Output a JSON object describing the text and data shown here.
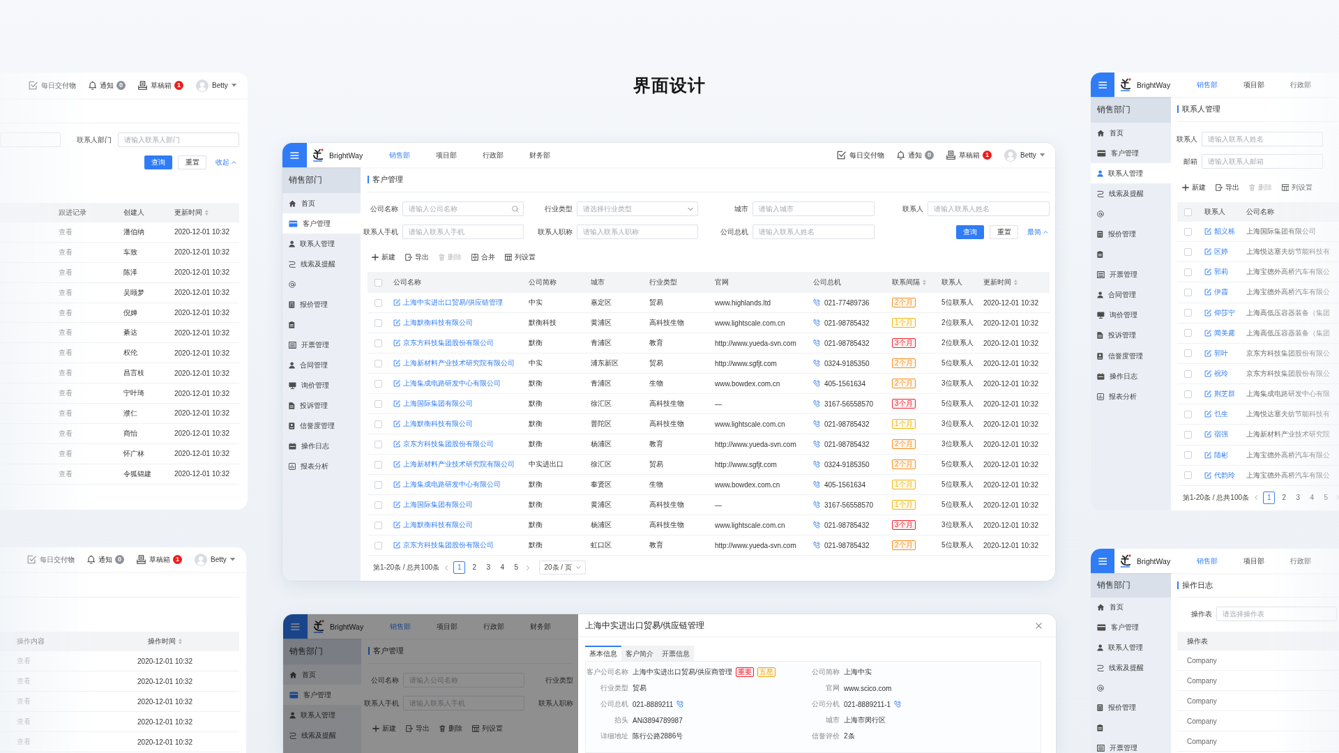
{
  "page_title": "界面设计",
  "customer_window": {
    "header": {
      "logo": "BrightWay",
      "nav": [
        {
          "label": "销售部",
          "selected": true
        },
        {
          "label": "项目部",
          "selected": false
        },
        {
          "label": "行政部",
          "selected": false
        },
        {
          "label": "财务部",
          "selected": false
        }
      ],
      "tools": [
        {
          "kind": "deliverables",
          "label": "每日交付物"
        },
        {
          "kind": "notices",
          "label": "通知",
          "badge": "0"
        },
        {
          "kind": "drafts",
          "label": "草稿箱",
          "badge": "1"
        }
      ],
      "user": "Betty"
    },
    "sidebar": {
      "title": "销售部门",
      "items": [
        {
          "kind": "home",
          "label": "首页",
          "selected": false
        },
        {
          "kind": "customers",
          "label": "客户管理",
          "selected": true
        },
        {
          "kind": "contacts",
          "label": "联系人管理",
          "selected": false
        },
        {
          "kind": "leads",
          "label": "线索及提醒",
          "selected": false
        },
        {
          "kind": "mentions",
          "selected": false
        },
        {
          "kind": "quotes",
          "label": "报价管理",
          "selected": false
        },
        {
          "kind": "clipboard",
          "selected": false
        },
        {
          "kind": "invoices",
          "label": "开票管理",
          "selected": false
        },
        {
          "kind": "contracts",
          "label": "合同管理",
          "selected": false
        },
        {
          "kind": "inquiries",
          "label": "询价管理",
          "selected": false
        },
        {
          "kind": "complaints",
          "label": "投诉管理",
          "selected": false
        },
        {
          "kind": "credit",
          "label": "信誉度管理",
          "selected": false
        },
        {
          "kind": "logs",
          "label": "操作日志",
          "selected": false
        },
        {
          "kind": "reports",
          "label": "报表分析",
          "selected": false
        }
      ]
    },
    "breadcrumb": "客户管理",
    "filter_rows": [
      [
        {
          "label": "公司名称",
          "kind": "search",
          "placeholder": "请输入公司名称"
        },
        {
          "label": "行业类型",
          "kind": "select",
          "placeholder": "请选择行业类型"
        },
        {
          "label": "城市",
          "kind": "text",
          "placeholder": "请输入城市"
        },
        {
          "label": "联系人",
          "kind": "text",
          "placeholder": "请输入联系人姓名"
        }
      ],
      [
        {
          "label": "联系人手机",
          "kind": "text",
          "placeholder": "请输入联系人手机"
        },
        {
          "label": "联系人职称",
          "kind": "text",
          "placeholder": "请输入联系人职称"
        },
        {
          "label": "公司总机",
          "kind": "text",
          "placeholder": "请输入联系人姓名"
        }
      ]
    ],
    "actions": {
      "query": "查询",
      "reset": "重置",
      "toggle": "最简"
    },
    "toolbar": [
      {
        "kind": "add",
        "label": "新建",
        "disabled": false
      },
      {
        "kind": "export",
        "label": "导出",
        "disabled": false
      },
      {
        "kind": "delete",
        "label": "删除",
        "disabled": true
      },
      {
        "kind": "merge",
        "label": "合并",
        "disabled": false
      },
      {
        "kind": "columns",
        "label": "列设置",
        "disabled": false
      }
    ],
    "table": {
      "select_all_checked": false,
      "columns": [
        {
          "label": "公司名称",
          "sortable": false
        },
        {
          "label": "公司简称",
          "sortable": false
        },
        {
          "label": "城市",
          "sortable": false
        },
        {
          "label": "行业类型",
          "sortable": false
        },
        {
          "label": "官网",
          "sortable": false
        },
        {
          "label": "公司总机",
          "sortable": false
        },
        {
          "label": "联系间隔",
          "sortable": true
        },
        {
          "label": "联系人",
          "sortable": false
        },
        {
          "label": "更新时间",
          "sortable": true
        }
      ],
      "rows": [
        {
          "checked": false,
          "company": "上海中实进出口贸易/供应链管理",
          "short_name": "中实",
          "city": "嘉定区",
          "industry": "贸易",
          "website": "www.highlands.ltd",
          "phone": "021-77489736",
          "interval": {
            "label": "2个月",
            "color": "#fa8c16"
          },
          "contacts": "5位联系人",
          "updated": "2020-12-01 10:32"
        },
        {
          "checked": false,
          "company": "上海默衡科技有限公司",
          "short_name": "默衡科技",
          "city": "黄浦区",
          "industry": "高科技生物",
          "website": "www.lightscale.com.cn",
          "phone": "021-98785432",
          "interval": {
            "label": "1个月",
            "color": "#f2b705"
          },
          "contacts": "2位联系人",
          "updated": "2020-12-01 10:32"
        },
        {
          "checked": false,
          "company": "京东方科技集团股份有限公司",
          "short_name": "默衡",
          "city": "青浦区",
          "industry": "教育",
          "website": "http://www.yueda-svn.com",
          "phone": "021-98785432",
          "interval": {
            "label": "3个月",
            "color": "#f5222d"
          },
          "contacts": "2位联系人",
          "updated": "2020-12-01 10:32"
        },
        {
          "checked": false,
          "company": "上海新材料产业技术研究院有限公司",
          "short_name": "中实",
          "city": "浦东新区",
          "industry": "贸易",
          "website": "http://www.sgfjt.com",
          "phone": "0324-9185350",
          "interval": {
            "label": "2个月",
            "color": "#fa8c16"
          },
          "contacts": "5位联系人",
          "updated": "2020-12-01 10:32"
        },
        {
          "checked": false,
          "company": "上海集成电路研发中心有限公司",
          "short_name": "默衡",
          "city": "青浦区",
          "industry": "生物",
          "website": "www.bowdex.com.cn",
          "phone": "405-1561634",
          "interval": {
            "label": "2个月",
            "color": "#fa8c16"
          },
          "contacts": "3位联系人",
          "updated": "2020-12-01 10:32"
        },
        {
          "checked": false,
          "company": "上海国际集团有限公司",
          "short_name": "默衡",
          "city": "徐汇区",
          "industry": "高科技生物",
          "website": "—",
          "phone": "3167-56558570",
          "interval": {
            "label": "3个月",
            "color": "#f5222d"
          },
          "contacts": "5位联系人",
          "updated": "2020-12-01 10:32"
        },
        {
          "checked": false,
          "company": "上海默衡科技有限公司",
          "short_name": "默衡",
          "city": "普陀区",
          "industry": "高科技生物",
          "website": "www.lightscale.com.cn",
          "phone": "021-98785432",
          "interval": {
            "label": "1个月",
            "color": "#f2b705"
          },
          "contacts": "3位联系人",
          "updated": "2020-12-01 10:32"
        },
        {
          "checked": false,
          "company": "京东方科技集团股份有限公司",
          "short_name": "默衡",
          "city": "杨浦区",
          "industry": "教育",
          "website": "http://www.yueda-svn.com",
          "phone": "021-98785432",
          "interval": {
            "label": "2个月",
            "color": "#fa8c16"
          },
          "contacts": "3位联系人",
          "updated": "2020-12-01 10:32"
        },
        {
          "checked": false,
          "company": "上海新材料产业技术研究院有限公司",
          "short_name": "中实进出口",
          "city": "徐汇区",
          "industry": "贸易",
          "website": "http://www.sgfjt.com",
          "phone": "0324-9185350",
          "interval": {
            "label": "2个月",
            "color": "#fa8c16"
          },
          "contacts": "5位联系人",
          "updated": "2020-12-01 10:32"
        },
        {
          "checked": false,
          "company": "上海集成电路研发中心有限公司",
          "short_name": "默衡",
          "city": "奉贤区",
          "industry": "生物",
          "website": "www.bowdex.com.cn",
          "phone": "405-1561634",
          "interval": {
            "label": "1个月",
            "color": "#f2b705"
          },
          "contacts": "5位联系人",
          "updated": "2020-12-01 10:32"
        },
        {
          "checked": false,
          "company": "上海国际集团有限公司",
          "short_name": "默衡",
          "city": "黄浦区",
          "industry": "高科技生物",
          "website": "—",
          "phone": "3167-56558570",
          "interval": {
            "label": "1个月",
            "color": "#f2b705"
          },
          "contacts": "5位联系人",
          "updated": "2020-12-01 10:32"
        },
        {
          "checked": false,
          "company": "上海默衡科技有限公司",
          "short_name": "默衡",
          "city": "杨浦区",
          "industry": "高科技生物",
          "website": "www.lightscale.com.cn",
          "phone": "021-98785432",
          "interval": {
            "label": "3个月",
            "color": "#f5222d"
          },
          "contacts": "3位联系人",
          "updated": "2020-12-01 10:32"
        },
        {
          "checked": false,
          "company": "京东方科技集团股份有限公司",
          "short_name": "默衡",
          "city": "虹口区",
          "industry": "教育",
          "website": "http://www.yueda-svn.com",
          "phone": "021-98785432",
          "interval": {
            "label": "2个月",
            "color": "#fa8c16"
          },
          "contacts": "5位联系人",
          "updated": "2020-12-01 10:32"
        }
      ]
    },
    "pagination": {
      "summary": "第1-20条 / 总共100条",
      "pages": [
        {
          "label": "1",
          "selected": true
        },
        {
          "label": "2",
          "selected": false
        },
        {
          "label": "3",
          "selected": false
        },
        {
          "label": "4",
          "selected": false
        },
        {
          "label": "5",
          "selected": false
        }
      ],
      "page_size": "20条 / 页"
    }
  },
  "follow_up_window": {
    "header": {
      "tools": [
        {
          "kind": "deliverables",
          "label": "每日交付物"
        },
        {
          "kind": "notices",
          "label": "通知",
          "badge": "0"
        },
        {
          "kind": "drafts",
          "label": "草稿箱",
          "badge": "1"
        }
      ],
      "user": "Betty"
    },
    "filters": [
      {
        "kind": "text"
      },
      {
        "label": "联系人部门",
        "kind": "text",
        "placeholder": "请输入联系人部门"
      }
    ],
    "actions": {
      "query": "查询",
      "reset": "重置",
      "toggle": "收起"
    },
    "table": {
      "columns": [
        {
          "label": "跟进记录",
          "sortable": false
        },
        {
          "label": "创建人",
          "sortable": false
        },
        {
          "label": "更新时间",
          "sortable": true
        }
      ],
      "rows": [
        {
          "follow_up": "查看",
          "creator": "潘伯纳",
          "updated": "2020-12-01 10:32"
        },
        {
          "follow_up": "查看",
          "creator": "车致",
          "updated": "2020-12-01 10:32"
        },
        {
          "follow_up": "查看",
          "creator": "陈泽",
          "updated": "2020-12-01 10:32"
        },
        {
          "follow_up": "查看",
          "creator": "吴颐梦",
          "updated": "2020-12-01 10:32"
        },
        {
          "follow_up": "查看",
          "creator": "倪婵",
          "updated": "2020-12-01 10:32"
        },
        {
          "follow_up": "查看",
          "creator": "綦达",
          "updated": "2020-12-01 10:32"
        },
        {
          "follow_up": "查看",
          "creator": "权伦",
          "updated": "2020-12-01 10:32"
        },
        {
          "follow_up": "查看",
          "creator": "昌言枝",
          "updated": "2020-12-01 10:32"
        },
        {
          "follow_up": "查看",
          "creator": "宁叶琦",
          "updated": "2020-12-01 10:32"
        },
        {
          "follow_up": "查看",
          "creator": "濮仁",
          "updated": "2020-12-01 10:32"
        },
        {
          "follow_up": "查看",
          "creator": "商怡",
          "updated": "2020-12-01 10:32"
        },
        {
          "follow_up": "查看",
          "creator": "怀广林",
          "updated": "2020-12-01 10:32"
        },
        {
          "follow_up": "查看",
          "creator": "令狐锦建",
          "updated": "2020-12-01 10:32"
        }
      ]
    }
  },
  "log_window": {
    "header": {
      "tools": [
        {
          "kind": "deliverables",
          "label": "每日交付物"
        },
        {
          "kind": "notices",
          "label": "通知",
          "badge": "0"
        },
        {
          "kind": "drafts",
          "label": "草稿箱",
          "badge": "1"
        }
      ],
      "user": "Betty"
    },
    "table": {
      "columns": [
        {
          "label": "操作内容",
          "sortable": false
        },
        {
          "label": "操作时间",
          "sortable": true
        }
      ],
      "rows": [
        {
          "content": "查看",
          "time": "2020-12-01 10:32"
        },
        {
          "content": "查看",
          "time": "2020-12-01 10:32"
        },
        {
          "content": "查看",
          "time": "2020-12-01 10:32"
        },
        {
          "content": "查看",
          "time": "2020-12-01 10:32"
        },
        {
          "content": "查看",
          "time": "2020-12-01 10:32"
        }
      ]
    }
  },
  "contacts_window": {
    "header": {
      "logo": "BrightWay",
      "nav": [
        {
          "label": "销售部",
          "selected": true
        },
        {
          "label": "项目部",
          "selected": false
        },
        {
          "label": "行政部",
          "selected": false
        }
      ]
    },
    "sidebar": {
      "title": "销售部门",
      "items": [
        {
          "kind": "home",
          "label": "首页",
          "selected": false
        },
        {
          "kind": "customers",
          "label": "客户管理",
          "selected": false
        },
        {
          "kind": "contacts",
          "label": "联系人管理",
          "selected": true
        },
        {
          "kind": "leads",
          "label": "线索及提醒",
          "selected": false
        },
        {
          "kind": "mentions",
          "selected": false
        },
        {
          "kind": "quotes",
          "label": "报价管理",
          "selected": false
        },
        {
          "kind": "clipboard",
          "selected": false
        },
        {
          "kind": "invoices",
          "label": "开票管理",
          "selected": false
        },
        {
          "kind": "contracts",
          "label": "合同管理",
          "selected": false
        },
        {
          "kind": "inquiries",
          "label": "询价管理",
          "selected": false
        },
        {
          "kind": "complaints",
          "label": "投诉管理",
          "selected": false
        },
        {
          "kind": "credit",
          "label": "信誉度管理",
          "selected": false
        },
        {
          "kind": "logs",
          "label": "操作日志",
          "selected": false
        },
        {
          "kind": "reports",
          "label": "报表分析",
          "selected": false
        }
      ]
    },
    "breadcrumb": "联系人管理",
    "filter_rows": [
      [
        {
          "label": "联系人",
          "kind": "text",
          "placeholder": "请输入联系人姓名"
        }
      ],
      [
        {
          "label": "邮箱",
          "kind": "text",
          "placeholder": "请输入联系人邮箱"
        }
      ]
    ],
    "toolbar": [
      {
        "kind": "add",
        "label": "新建",
        "disabled": false
      },
      {
        "kind": "export",
        "label": "导出",
        "disabled": false
      },
      {
        "kind": "delete",
        "label": "删除",
        "disabled": true
      },
      {
        "kind": "columns",
        "label": "列设置",
        "disabled": false
      }
    ],
    "table": {
      "select_all_checked": false,
      "columns": [
        {
          "label": "联系人",
          "sortable": false
        },
        {
          "label": "公司名称",
          "sortable": false
        }
      ],
      "rows": [
        {
          "checked": false,
          "name": "韶义栋",
          "company": "上海国际集团有限公司"
        },
        {
          "checked": false,
          "name": "区婷",
          "company": "上海悦达塞夫纺节能科技有"
        },
        {
          "checked": false,
          "name": "郭莉",
          "company": "上海宝德外高桥汽车有限公"
        },
        {
          "checked": false,
          "name": "伊霞",
          "company": "上海宝德外高桥汽车有限公"
        },
        {
          "checked": false,
          "name": "仰莎宁",
          "company": "上海高低压容器装备（集团"
        },
        {
          "checked": false,
          "name": "闻美露",
          "company": "上海高低压容器装备（集团"
        },
        {
          "checked": false,
          "name": "郭叶",
          "company": "京东方科技集团股份有限公"
        },
        {
          "checked": false,
          "name": "祝玲",
          "company": "京东方科技集团股份有限公"
        },
        {
          "checked": false,
          "name": "荆芝群",
          "company": "上海集成电路研发中心有限"
        },
        {
          "checked": false,
          "name": "乜生",
          "company": "上海悦达塞夫纺节能科技有"
        },
        {
          "checked": false,
          "name": "宿强",
          "company": "上海新材料产业技术研究院"
        },
        {
          "checked": false,
          "name": "陆彬",
          "company": "上海宝德外高桥汽车有限公"
        },
        {
          "checked": false,
          "name": "代韵玲",
          "company": "上海宝德外高桥汽车有限公"
        }
      ]
    },
    "pagination": {
      "summary": "第1-20条 / 总共100条",
      "pages": [
        {
          "label": "1",
          "selected": true
        },
        {
          "label": "2",
          "selected": false
        },
        {
          "label": "3",
          "selected": false
        },
        {
          "label": "4",
          "selected": false
        },
        {
          "label": "5",
          "selected": false
        }
      ]
    }
  },
  "operation_log_window": {
    "header": {
      "logo": "BrightWay",
      "nav": [
        {
          "label": "销售部",
          "selected": true
        },
        {
          "label": "项目部",
          "selected": false
        },
        {
          "label": "行政部",
          "selected": false
        }
      ]
    },
    "sidebar": {
      "title": "销售部门",
      "items": [
        {
          "kind": "home",
          "label": "首页",
          "selected": false
        },
        {
          "kind": "customers",
          "label": "客户管理",
          "selected": false
        },
        {
          "kind": "contacts",
          "label": "联系人管理",
          "selected": false
        },
        {
          "kind": "leads",
          "label": "线索及提醒",
          "selected": false
        },
        {
          "kind": "mentions",
          "selected": false
        },
        {
          "kind": "quotes",
          "label": "报价管理",
          "selected": false
        },
        {
          "kind": "clipboard",
          "selected": false
        },
        {
          "kind": "invoices",
          "label": "开票管理",
          "selected": false
        }
      ]
    },
    "breadcrumb": "操作日志",
    "filter_rows": [
      [
        {
          "label": "操作表",
          "kind": "text",
          "placeholder": "请选择操作表"
        }
      ]
    ],
    "table": {
      "columns": [
        {
          "label": "操作表",
          "sortable": false
        }
      ],
      "rows": [
        {
          "table": "Company"
        },
        {
          "table": "Company"
        },
        {
          "table": "Company"
        },
        {
          "table": "Company"
        },
        {
          "table": "Company"
        }
      ]
    }
  },
  "detail_window": {
    "background": {
      "header": {
        "logo": "BrightWay",
        "nav": [
          {
            "label": "销售部",
            "selected": true
          },
          {
            "label": "项目部",
            "selected": false
          },
          {
            "label": "行政部",
            "selected": false
          },
          {
            "label": "财务部",
            "selected": false
          }
        ]
      },
      "sidebar": {
        "title": "销售部门",
        "items": [
          {
            "kind": "home",
            "label": "首页",
            "selected": false
          },
          {
            "kind": "customers",
            "label": "客户管理",
            "selected": true
          },
          {
            "kind": "contacts",
            "label": "联系人管理",
            "selected": false
          },
          {
            "kind": "leads",
            "label": "线索及提醒",
            "selected": false
          }
        ]
      },
      "breadcrumb": "客户管理",
      "filter_rows": [
        [
          {
            "label": "公司名称",
            "kind": "text",
            "placeholder": "请输入公司名称"
          },
          {
            "label": "行业类型"
          }
        ],
        [
          {
            "label": "联系人手机",
            "kind": "text",
            "placeholder": "请输入联系人手机"
          },
          {
            "label": "联系人职称"
          }
        ]
      ],
      "toolbar": [
        {
          "kind": "add",
          "label": "新建",
          "disabled": false
        },
        {
          "kind": "export",
          "label": "导出",
          "disabled": false
        },
        {
          "kind": "delete",
          "label": "删除",
          "disabled": false
        },
        {
          "kind": "columns",
          "label": "列设置",
          "disabled": false
        }
      ]
    },
    "drawer": {
      "title": "上海中实进出口贸易/供应链管理",
      "tabs": [
        {
          "label": "基本信息",
          "selected": true
        },
        {
          "label": "客户简介",
          "selected": false
        },
        {
          "label": "开票信息",
          "selected": false
        }
      ],
      "fields": [
        {
          "label": "客户公司名称",
          "kind": "text",
          "value": "上海中实进出口贸易/供应商管理",
          "tags": [
            {
              "label": "重要",
              "color": "#f5222d"
            },
            {
              "label": "五星",
              "color": "#f0a500"
            }
          ]
        },
        {
          "label": "公司简称",
          "kind": "text",
          "value": "上海中实"
        },
        {
          "label": "行业类型",
          "kind": "text",
          "value": "贸易"
        },
        {
          "label": "官网",
          "kind": "text",
          "value": "www.scico.com"
        },
        {
          "label": "公司总机",
          "kind": "phone",
          "value": "021-8889211"
        },
        {
          "label": "公司分机",
          "kind": "phone",
          "value": "021-8889211-1"
        },
        {
          "label": "抬头",
          "kind": "text",
          "value": "ANi3894789987"
        },
        {
          "label": "城市",
          "kind": "text",
          "value": "上海市闵行区"
        },
        {
          "label": "详细地址",
          "kind": "text",
          "value": "陈行公路2886号"
        },
        {
          "label": "信誉评价",
          "kind": "text",
          "value": "2条"
        }
      ]
    }
  }
}
